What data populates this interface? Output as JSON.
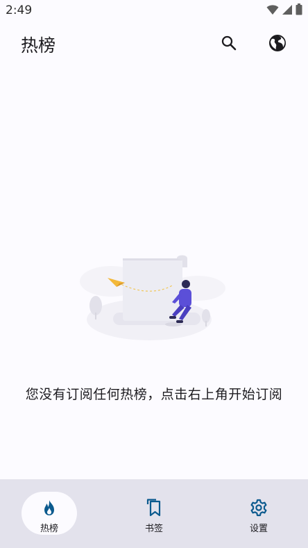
{
  "status_bar": {
    "time": "2:49",
    "icons": [
      "wifi-icon",
      "cell-signal-icon",
      "battery-icon"
    ]
  },
  "app_bar": {
    "title": "热榜",
    "actions": [
      "search-icon",
      "globe-icon"
    ]
  },
  "empty_state": {
    "message": "您没有订阅任何热榜，点击右上角开始订阅"
  },
  "bottom_nav": {
    "items": [
      {
        "label": "热榜",
        "icon": "fire-icon",
        "active": true
      },
      {
        "label": "书签",
        "icon": "bookmarks-icon",
        "active": false
      },
      {
        "label": "设置",
        "icon": "settings-gear-icon",
        "active": false
      }
    ]
  },
  "colors": {
    "background": "#fcfbff",
    "nav_background": "#e3e2ec",
    "accent": "#0b5a8e",
    "illustration_purple": "#5b4fd8"
  }
}
